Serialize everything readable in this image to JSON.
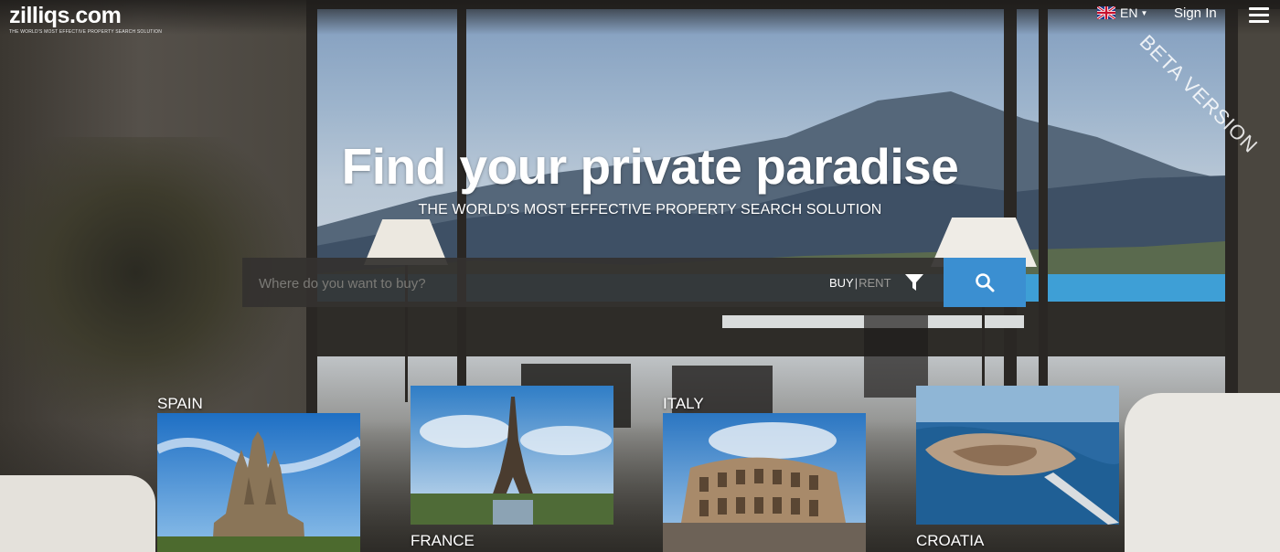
{
  "header": {
    "logo_text": "zilliqs.com",
    "logo_tagline": "THE WORLD'S MOST EFFECTIVE PROPERTY SEARCH SOLUTION",
    "language": "EN",
    "sign_in_label": "Sign In",
    "beta_label": "BETA VERSION"
  },
  "hero": {
    "title": "Find your private paradise",
    "subtitle": "THE WORLD'S MOST EFFECTIVE PROPERTY SEARCH SOLUTION"
  },
  "search": {
    "placeholder": "Where do you want to buy?",
    "value": "",
    "buy_label": "BUY",
    "separator": "|",
    "rent_label": "RENT",
    "accent_color": "#3b8fd1"
  },
  "destinations": [
    {
      "label": "SPAIN"
    },
    {
      "label": "FRANCE"
    },
    {
      "label": "ITALY"
    },
    {
      "label": "CROATIA"
    }
  ],
  "icons": {
    "language_flag": "uk-flag-icon",
    "dropdown": "caret-down-icon",
    "menu": "hamburger-menu-icon",
    "filter": "filter-icon",
    "search": "search-icon"
  }
}
